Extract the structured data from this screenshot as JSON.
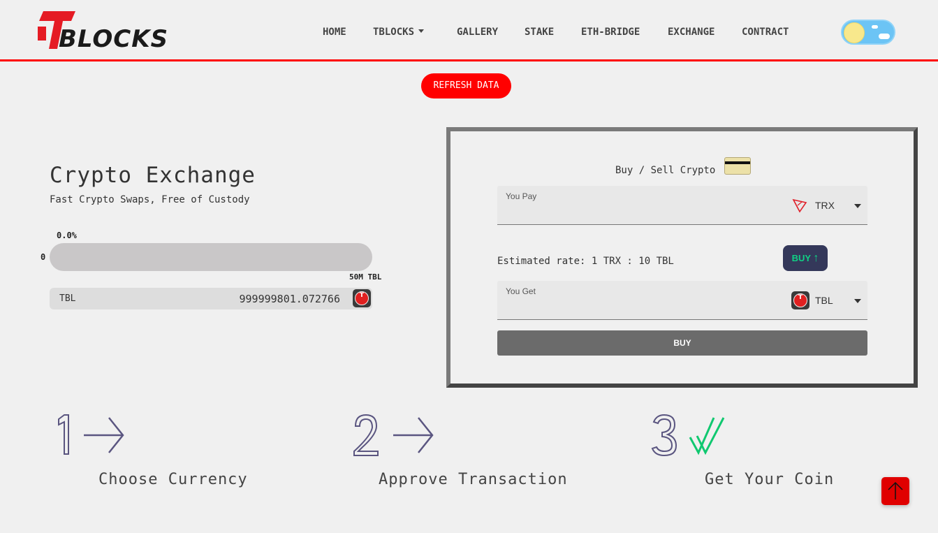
{
  "brand": {
    "logo_text": "BLOCKS"
  },
  "nav": {
    "items": [
      {
        "label": "HOME"
      },
      {
        "label": "TBLOCKS",
        "has_dropdown": true
      },
      {
        "label": "GALLERY"
      },
      {
        "label": "STAKE"
      },
      {
        "label": "ETH-BRIDGE"
      },
      {
        "label": "EXCHANGE"
      },
      {
        "label": "CONTRACT"
      }
    ],
    "theme_toggle_icon": "sun-cloud-toggle"
  },
  "refresh_button": {
    "label": "REFRESH DATA"
  },
  "hero": {
    "title": "Crypto Exchange",
    "subtitle": "Fast Crypto Swaps, Free of Custody"
  },
  "sale_progress": {
    "percent_label": "0.0%",
    "percent": 0.0,
    "min_label": "0",
    "max_label": "50M TBL"
  },
  "balance": {
    "symbol": "TBL",
    "amount": "999999801.072766",
    "icon": "tbl-coin-icon"
  },
  "exchange_card": {
    "title": "Buy / Sell Crypto",
    "title_icon": "credit-card-icon",
    "pay": {
      "label": "You Pay",
      "currency": "TRX",
      "icon": "tron-icon"
    },
    "rate": "Estimated rate: 1 TRX : 10 TBL",
    "mode_toggle": {
      "label": "BUY",
      "icon": "arrow-up-icon"
    },
    "get": {
      "label": "You Get",
      "currency": "TBL",
      "icon": "tbl-coin-icon"
    },
    "submit_label": "BUY"
  },
  "steps": [
    {
      "number": "1",
      "icon": "arrow-right-icon",
      "label": "Choose Currency"
    },
    {
      "number": "2",
      "icon": "arrow-right-icon",
      "label": "Approve Transaction"
    },
    {
      "number": "3",
      "icon": "double-check-icon",
      "label": "Get Your Coin"
    }
  ],
  "colors": {
    "accent": "#ff0000",
    "background": "#f0f0f0",
    "step_outline": "#5a5580",
    "check_green": "#10c870",
    "buy_toggle_bg": "#34385a"
  },
  "scroll_top_icon": "arrow-up-icon"
}
